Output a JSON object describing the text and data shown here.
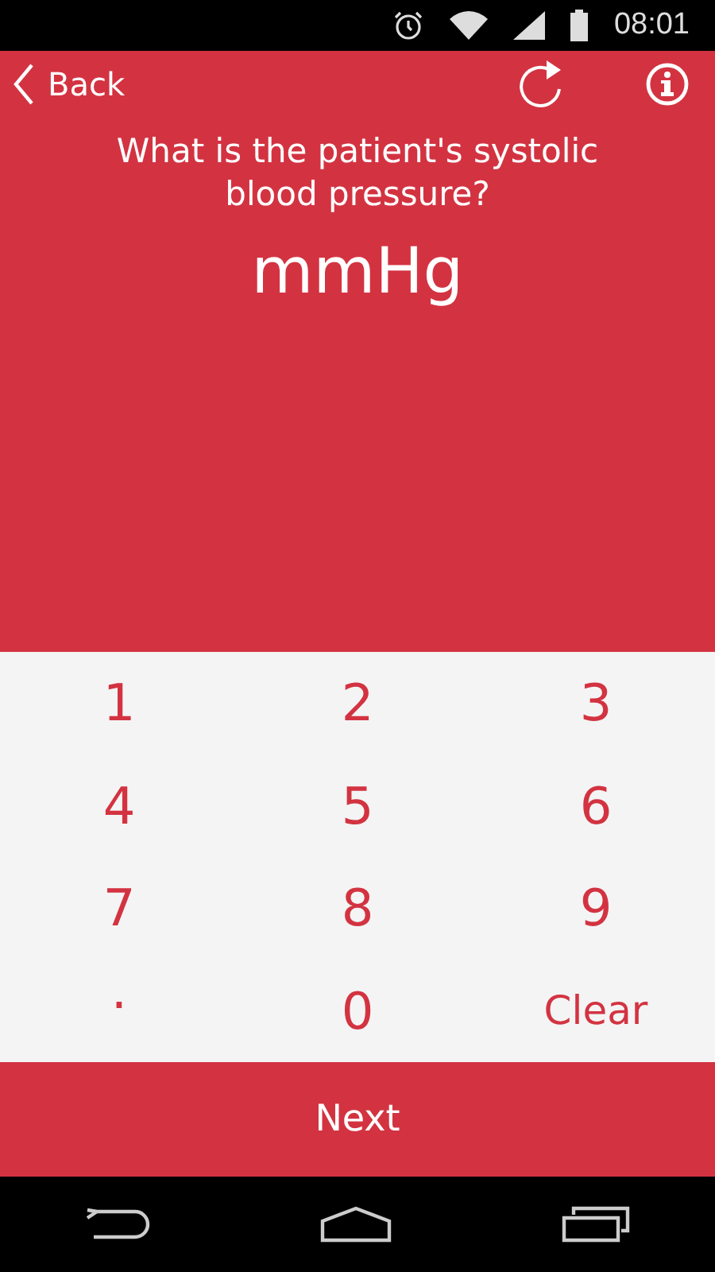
{
  "status_bar": {
    "time": "08:01"
  },
  "header": {
    "back": "Back"
  },
  "question": "What is the patient's systolic blood pressure?",
  "unit": "mmHg",
  "keypad": [
    {
      "kind": "digit",
      "label": "1"
    },
    {
      "kind": "digit",
      "label": "2"
    },
    {
      "kind": "digit",
      "label": "3"
    },
    {
      "kind": "digit",
      "label": "4"
    },
    {
      "kind": "digit",
      "label": "5"
    },
    {
      "kind": "digit",
      "label": "6"
    },
    {
      "kind": "digit",
      "label": "7"
    },
    {
      "kind": "digit",
      "label": "8"
    },
    {
      "kind": "digit",
      "label": "9"
    },
    {
      "kind": "decimal",
      "label": "."
    },
    {
      "kind": "digit",
      "label": "0"
    },
    {
      "kind": "clear",
      "label": "Clear"
    }
  ],
  "next": "Next"
}
